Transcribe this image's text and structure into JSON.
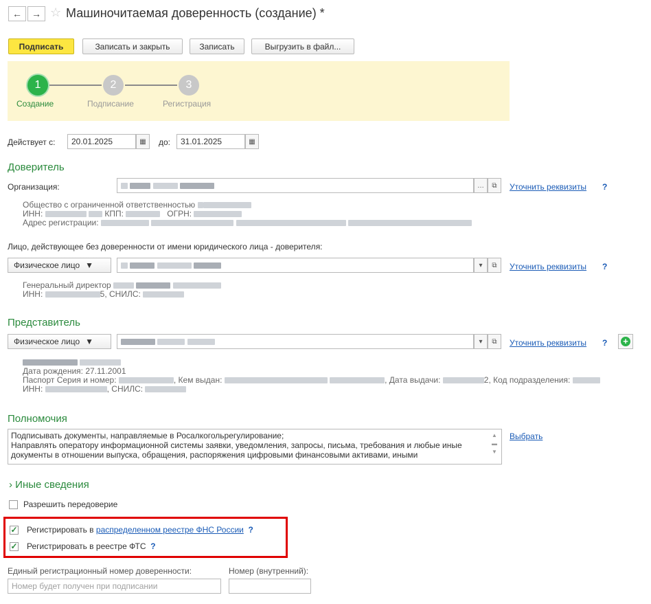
{
  "window": {
    "title": "Машиночитаемая доверенность (создание) *",
    "back_icon": "←",
    "forward_icon": "→",
    "star_icon": "☆"
  },
  "toolbar": {
    "sign": "Подписать",
    "save_close": "Записать и закрыть",
    "save": "Записать",
    "export": "Выгрузить в файл..."
  },
  "wizard": {
    "steps": [
      {
        "num": "1",
        "label": "Создание"
      },
      {
        "num": "2",
        "label": "Подписание"
      },
      {
        "num": "3",
        "label": "Регистрация"
      }
    ]
  },
  "validity": {
    "from_label": "Действует с:",
    "from_value": "20.01.2025",
    "to_label": "до:",
    "to_value": "31.01.2025"
  },
  "principal": {
    "section_title": "Доверитель",
    "org_label": "Организация:",
    "clarify_link": "Уточнить реквизиты",
    "help": "?",
    "org_info_line1": "Общество с ограниченной ответственностью",
    "inn_label": "ИНН:",
    "kpp_label": "КПП:",
    "ogrn_label": "ОГРН:",
    "address_label": "Адрес регистрации:",
    "person_caption": "Лицо, действующее без доверенности от имени юридического лица - доверителя:",
    "person_type": "Физическое лицо",
    "person_clarify_link": "Уточнить реквизиты",
    "person_position": "Генеральный директор",
    "person_inn_label": "ИНН:",
    "person_snils_label": ", СНИЛС:",
    "person_inn_tail": "5"
  },
  "representative": {
    "section_title": "Представитель",
    "person_type": "Физическое лицо",
    "clarify_link": "Уточнить реквизиты",
    "birth": "Дата рождения: 27.11.2001",
    "passport_label": "Паспорт Серия и номер:",
    "issued_label": ", Кем выдан:",
    "issue_date_label": ", Дата выдачи:",
    "issue_date_tail": "2",
    "subdivision_label": ", Код подразделения:",
    "inn_label": "ИНН:",
    "snils_label": ", СНИЛС:"
  },
  "powers": {
    "section_title": "Полномочия",
    "text": "Подписывать документы, направляемые в Росалкогольрегулирование;\nНаправлять оператору информационной системы заявки, уведомления, запросы, письма, требования и любые иные документы в отношении выпуска, обращения, распоряжения цифровыми финансовыми активами, иными",
    "select_link": "Выбрать"
  },
  "other": {
    "section_title": "Иные сведения",
    "chevron_icon": "›",
    "allow_redelegation": "Разрешить передоверие",
    "reg_fns_prefix": "Регистрировать в ",
    "reg_fns_link": "распределенном реестре ФНС России",
    "reg_fts": "Регистрировать в реестре ФТС",
    "reg_number_label": "Единый регистрационный номер доверенности:",
    "reg_number_placeholder": "Номер будет получен при подписании",
    "internal_number_label": "Номер (внутренний):",
    "internal_number_value": ""
  },
  "colors": {
    "accent_green": "#2a8a3c",
    "primary_button": "#fde641",
    "wizard_bg": "#fdf6d1",
    "highlight_red": "#e00000",
    "link_blue": "#1a5bb6"
  }
}
